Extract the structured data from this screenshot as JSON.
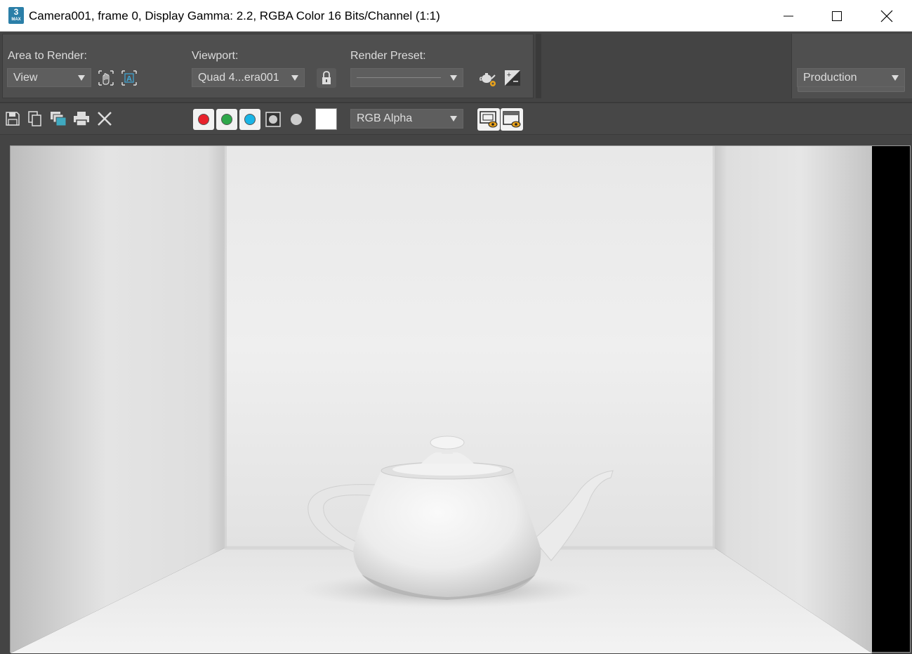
{
  "window": {
    "title": "Camera001, frame 0, Display Gamma: 2.2, RGBA Color 16 Bits/Channel (1:1)",
    "app_icon_text": "3",
    "app_icon_sub": "MAX"
  },
  "top_panel": {
    "area_to_render": {
      "label": "Area to Render:",
      "value": "View"
    },
    "viewport": {
      "label": "Viewport:",
      "value": "Quad 4...era001"
    },
    "render_preset": {
      "label": "Render Preset:",
      "value": ""
    },
    "render_button": "Render",
    "production_dropdown": "Production"
  },
  "toolbar": {
    "channel_display": "RGB Alpha",
    "channel_colors": {
      "red": "#e8212b",
      "green": "#2ea84a",
      "blue": "#1ab5e6"
    }
  },
  "colors": {
    "panel_bg": "#444444",
    "group_bg": "#4f4f4f",
    "text": "#dddddd"
  }
}
